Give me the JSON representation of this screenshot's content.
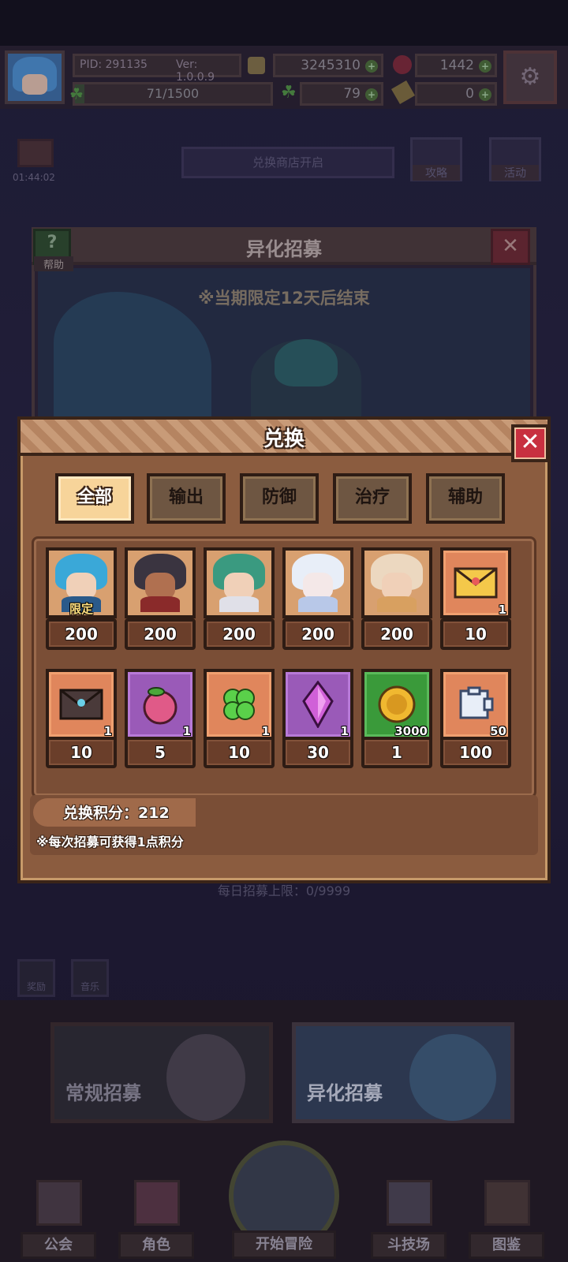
{
  "background": {
    "store_sign": "兑换商店开启",
    "timer": "01:44:02",
    "side_buttons": [
      "攻略",
      "活动"
    ],
    "recruit_panel": {
      "help_label": "帮助",
      "title": "异化招募",
      "limited_notice": "※当期限定12天后结束",
      "daily_limit": "每日招募上限：0/9999"
    },
    "small_icons": [
      "奖励",
      "音乐"
    ],
    "recruit_cards": [
      "常规招募",
      "异化招募"
    ]
  },
  "top_bar": {
    "pid": "PID: 291135",
    "version": "Ver: 1.0.0.9",
    "exp": "71/1500",
    "exp_progress": 0.047,
    "gold": "3245310",
    "gems": "1442",
    "clovers": "79",
    "tickets": "0"
  },
  "dialog": {
    "title": "兑换",
    "tabs": [
      {
        "label": "全部",
        "active": true
      },
      {
        "label": "输出",
        "active": false
      },
      {
        "label": "防御",
        "active": false
      },
      {
        "label": "治疗",
        "active": false
      },
      {
        "label": "辅助",
        "active": false
      }
    ],
    "items_row1": [
      {
        "kind": "hero-blue",
        "tag": "限定",
        "qty": "",
        "price": "200"
      },
      {
        "kind": "hero-dark",
        "tag": "",
        "qty": "",
        "price": "200"
      },
      {
        "kind": "hero-green",
        "tag": "",
        "qty": "",
        "price": "200"
      },
      {
        "kind": "hero-white",
        "tag": "",
        "qty": "",
        "price": "200"
      },
      {
        "kind": "hero-blonde",
        "tag": "",
        "qty": "",
        "price": "200"
      },
      {
        "kind": "yellow-letter",
        "tag": "",
        "qty": "1",
        "price": "10"
      }
    ],
    "items_row2": [
      {
        "kind": "dark-letter",
        "tag": "",
        "qty": "1",
        "price": "10"
      },
      {
        "kind": "peach",
        "tag": "",
        "qty": "1",
        "price": "5"
      },
      {
        "kind": "clover",
        "tag": "",
        "qty": "1",
        "price": "10"
      },
      {
        "kind": "crystal",
        "tag": "",
        "qty": "1",
        "price": "30"
      },
      {
        "kind": "gold-coin",
        "tag": "",
        "qty": "3000",
        "price": "1"
      },
      {
        "kind": "ticket",
        "tag": "",
        "qty": "50",
        "price": "100"
      }
    ],
    "points_label": "兑换积分：212",
    "points_note": "※每次招募可获得1点积分"
  },
  "bottom_nav": [
    {
      "label": "公会",
      "icon": "guild-icon"
    },
    {
      "label": "角色",
      "icon": "character-icon"
    },
    {
      "label": "开始冒险",
      "icon": "magnifier-icon"
    },
    {
      "label": "斗技场",
      "icon": "swords-icon"
    },
    {
      "label": "图鉴",
      "icon": "book-icon"
    }
  ],
  "colors": {
    "accent_red": "#c83040",
    "tab_active": "#f7d49a",
    "dialog_brown": "#8b5c3f"
  }
}
